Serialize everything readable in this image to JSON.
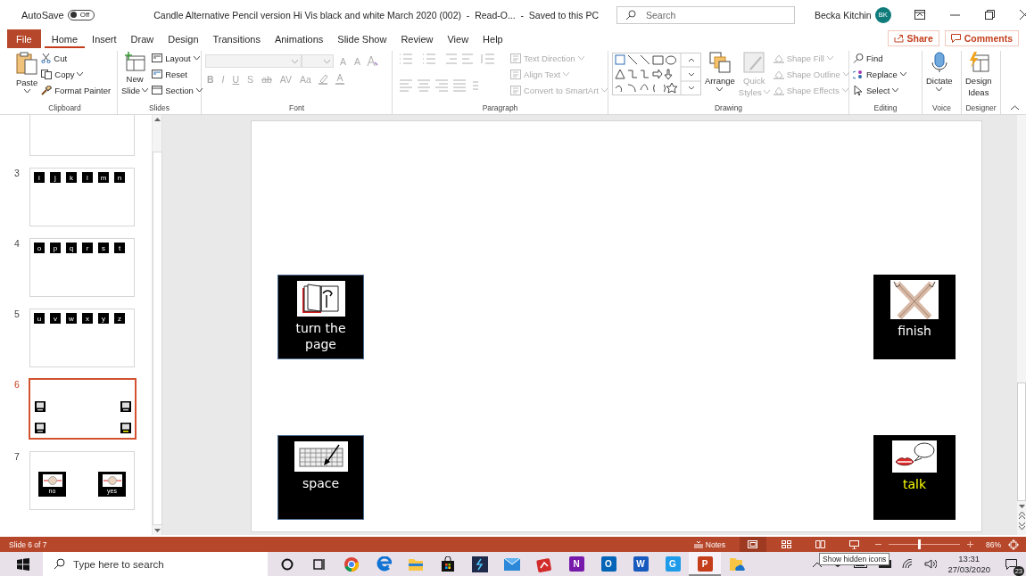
{
  "title_bar": {
    "autosave_label": "AutoSave",
    "autosave": {
      "label": "Off",
      "on": false
    },
    "document_title": "Candle Alternative Pencil version Hi Vis black and white March 2020 (002)  -  Read-O...  -  Saved to this PC",
    "search": {
      "placeholder": "Search"
    },
    "user_name": "Becka Kitchin",
    "avatar": "BK"
  },
  "tabs": [
    {
      "label": "File",
      "kind": "file",
      "selected": false
    },
    {
      "label": "Home",
      "kind": "tab",
      "selected": true
    },
    {
      "label": "Insert",
      "kind": "tab",
      "selected": false
    },
    {
      "label": "Draw",
      "kind": "tab",
      "selected": false
    },
    {
      "label": "Design",
      "kind": "tab",
      "selected": false
    },
    {
      "label": "Transitions",
      "kind": "tab",
      "selected": false
    },
    {
      "label": "Animations",
      "kind": "tab",
      "selected": false
    },
    {
      "label": "Slide Show",
      "kind": "tab",
      "selected": false
    },
    {
      "label": "Review",
      "kind": "tab",
      "selected": false
    },
    {
      "label": "View",
      "kind": "tab",
      "selected": false
    },
    {
      "label": "Help",
      "kind": "tab",
      "selected": false
    }
  ],
  "share": "Share",
  "comments": "Comments",
  "ribbon": {
    "clipboard": {
      "label": "Clipboard",
      "paste": "Paste",
      "items": [
        "Cut",
        "Copy",
        "Format Painter"
      ]
    },
    "slides": {
      "label": "Slides",
      "new_slide": [
        "New",
        "Slide"
      ],
      "items": [
        "Layout",
        "Reset",
        "Section"
      ]
    },
    "font": {
      "label": "Font",
      "size_buttons": [
        "A",
        "A"
      ],
      "format_buttons": [
        "B",
        "I",
        "U",
        "S",
        "ab",
        "AV",
        "Aa"
      ]
    },
    "paragraph": {
      "label": "Paragraph",
      "items": [
        "Text Direction",
        "Align Text",
        "Convert to SmartArt"
      ]
    },
    "drawing": {
      "label": "Drawing",
      "arrange": "Arrange",
      "quick_styles": [
        "Quick",
        "Styles"
      ],
      "items": [
        "Shape Fill",
        "Shape Outline",
        "Shape Effects"
      ]
    },
    "editing": {
      "label": "Editing",
      "items": [
        "Find",
        "Replace",
        "Select"
      ]
    },
    "voice": {
      "label": "Voice",
      "button": "Dictate"
    },
    "designer": {
      "label": "Designer",
      "button": [
        "Design",
        "Ideas"
      ]
    }
  },
  "thumbnails": [
    {
      "kind": "blank",
      "selected": false
    },
    {
      "number": "3",
      "kind": "letters",
      "letters": [
        "i",
        "j",
        "k",
        "l",
        "m",
        "n"
      ],
      "selected": false
    },
    {
      "number": "4",
      "kind": "letters",
      "letters": [
        "o",
        "p",
        "q",
        "r",
        "s",
        "t"
      ],
      "selected": false
    },
    {
      "number": "5",
      "kind": "letters",
      "letters": [
        "u",
        "v",
        "w",
        "x",
        "y",
        "z"
      ],
      "selected": false
    },
    {
      "number": "6",
      "kind": "symbols",
      "selected": true
    },
    {
      "number": "7",
      "kind": "choices",
      "labels": [
        "no",
        "yes"
      ],
      "selected": false
    }
  ],
  "slide": {
    "cards": [
      {
        "kind": "book",
        "label": "turn the page",
        "color": "#ffffff"
      },
      {
        "kind": "crossed-arms",
        "label": "finish",
        "color": "#ffffff"
      },
      {
        "kind": "keyboard",
        "label": "space",
        "color": "#ffffff"
      },
      {
        "kind": "talk",
        "label": "talk",
        "color": "#ffff00"
      }
    ]
  },
  "status_bar": {
    "slide_info": "Slide 6 of 7",
    "notes": "Notes",
    "views": [
      {
        "kind": "normal",
        "selected": true
      },
      {
        "kind": "sorter",
        "selected": false
      },
      {
        "kind": "reading",
        "selected": false
      },
      {
        "kind": "show",
        "selected": false
      }
    ],
    "zoom": {
      "level": 0.42
    },
    "zoom_text": "86%"
  },
  "taskbar": {
    "search": {
      "placeholder": "Type here to search"
    },
    "apps": [
      {
        "kind": "cortana",
        "active": false
      },
      {
        "kind": "taskview",
        "active": false
      },
      {
        "kind": "chrome",
        "active": false
      },
      {
        "kind": "edge",
        "active": false
      },
      {
        "kind": "explorer",
        "active": false
      },
      {
        "kind": "store",
        "active": false
      },
      {
        "kind": "dark",
        "active": false
      },
      {
        "kind": "mail",
        "active": false
      },
      {
        "kind": "red",
        "active": false
      },
      {
        "kind": "letter",
        "label": "N",
        "color": "#7719aa",
        "active": false
      },
      {
        "kind": "letter",
        "label": "O",
        "color": "#0364b8",
        "active": false
      },
      {
        "kind": "letter",
        "label": "W",
        "color": "#185abd",
        "active": false
      },
      {
        "kind": "letter",
        "label": "G",
        "color": "#1e9be9",
        "active": false
      },
      {
        "kind": "letter",
        "label": "P",
        "color": "#c43e1c",
        "active": true
      },
      {
        "kind": "onedrive",
        "active": false
      }
    ],
    "tooltip": "Show hidden icons",
    "time": "13:31",
    "date": "27/03/2020",
    "notifications": "23"
  }
}
